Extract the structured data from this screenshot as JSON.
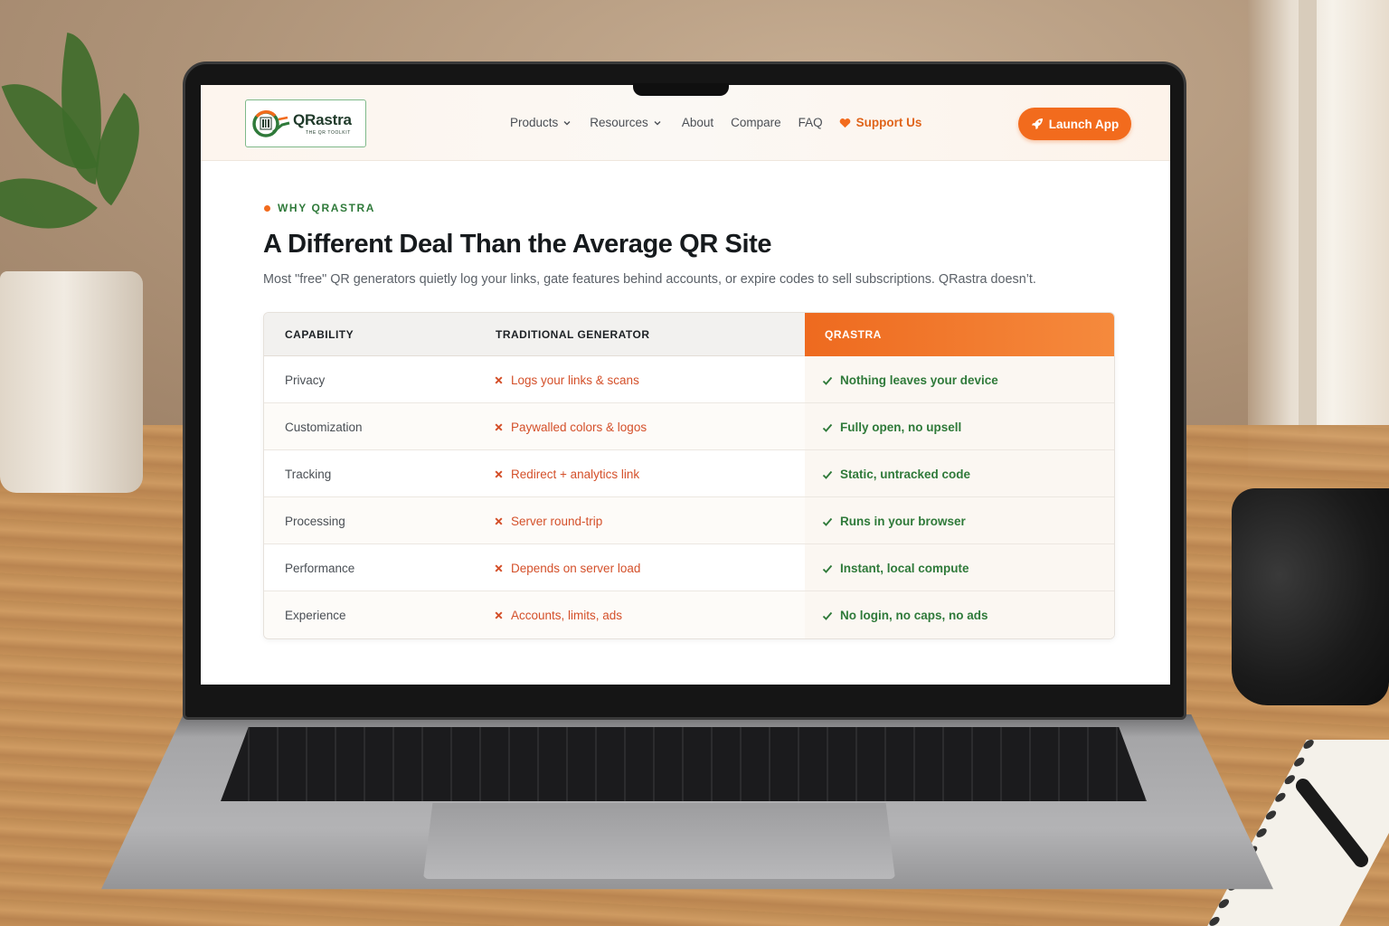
{
  "logo": {
    "name": "QRastra",
    "tagline": "THE QR TOOLKIT"
  },
  "nav": {
    "products": "Products",
    "resources": "Resources",
    "about": "About",
    "compare": "Compare",
    "faq": "FAQ",
    "support": "Support Us",
    "launch": "Launch App"
  },
  "section": {
    "eyebrow": "WHY QRASTRA",
    "title": "A Different Deal Than the Average QR Site",
    "subtitle": "Most \"free\" QR generators quietly log your links, gate features behind accounts, or expire codes to sell subscriptions. QRastra doesn’t."
  },
  "table": {
    "headers": [
      "CAPABILITY",
      "TRADITIONAL GENERATOR",
      "QRASTRA"
    ],
    "rows": [
      {
        "capability": "Privacy",
        "traditional": "Logs your links & scans",
        "qrastra": "Nothing leaves your device"
      },
      {
        "capability": "Customization",
        "traditional": "Paywalled colors & logos",
        "qrastra": "Fully open, no upsell"
      },
      {
        "capability": "Tracking",
        "traditional": "Redirect + analytics link",
        "qrastra": "Static, untracked code"
      },
      {
        "capability": "Processing",
        "traditional": "Server round-trip",
        "qrastra": "Runs in your browser"
      },
      {
        "capability": "Performance",
        "traditional": "Depends on server load",
        "qrastra": "Instant, local compute"
      },
      {
        "capability": "Experience",
        "traditional": "Accounts, limits, ads",
        "qrastra": "No login, no caps, no ads"
      }
    ]
  },
  "colors": {
    "accent": "#f26b1d",
    "brand_green": "#2f7a3a",
    "negative": "#d4502a"
  },
  "icons": {
    "cross": "x-icon",
    "check": "check-icon",
    "heart": "heart-icon",
    "rocket": "rocket-icon",
    "chevron": "chevron-down-icon"
  }
}
